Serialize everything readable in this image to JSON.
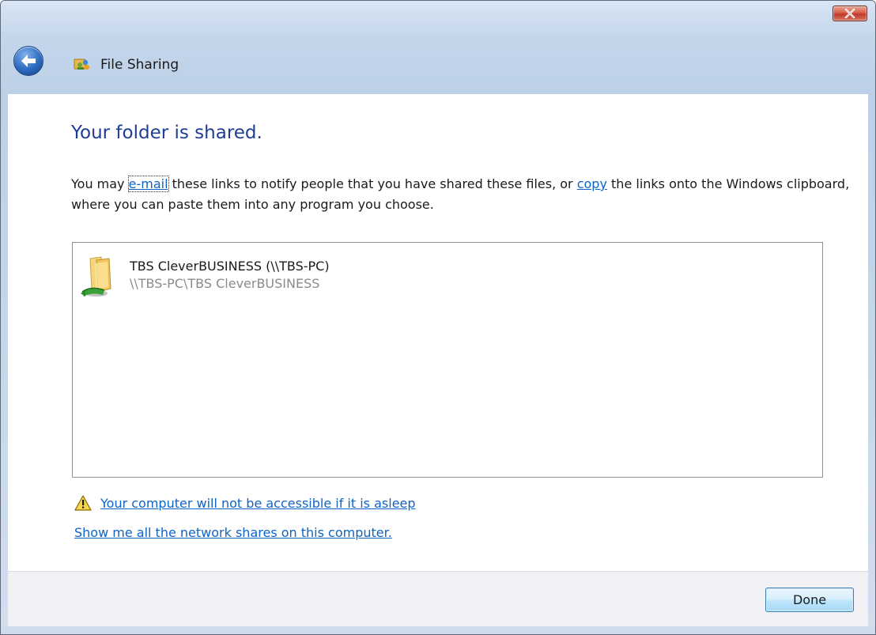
{
  "window": {
    "title": "File Sharing",
    "close_icon": "close-icon",
    "back_icon": "back-arrow-icon",
    "title_icon": "file-sharing-icon"
  },
  "main": {
    "heading": "Your folder is shared.",
    "para_before_email": "You may ",
    "email_link": "e-mail",
    "para_middle": " these links to notify people that you have shared these files, or ",
    "copy_link": "copy",
    "para_after_copy": " the links onto the Windows clipboard, where you can paste them into any program you choose."
  },
  "shared_items": [
    {
      "name": "TBS CleverBUSINESS (\\\\TBS-PC)",
      "path": "\\\\TBS-PC\\TBS CleverBUSINESS",
      "icon": "shared-folder-icon"
    }
  ],
  "links": {
    "sleep_warning": "Your computer will not be accessible if it is asleep",
    "network_shares": "Show me all the network shares on this computer.",
    "warning_icon": "warning-icon"
  },
  "footer": {
    "done_label": "Done"
  },
  "colors": {
    "heading": "#1f3d96",
    "link": "#0f64c4",
    "path_text": "#8b8b8b",
    "titlebar": "#c4d6ea",
    "footer_bg": "#f0f0f5"
  }
}
